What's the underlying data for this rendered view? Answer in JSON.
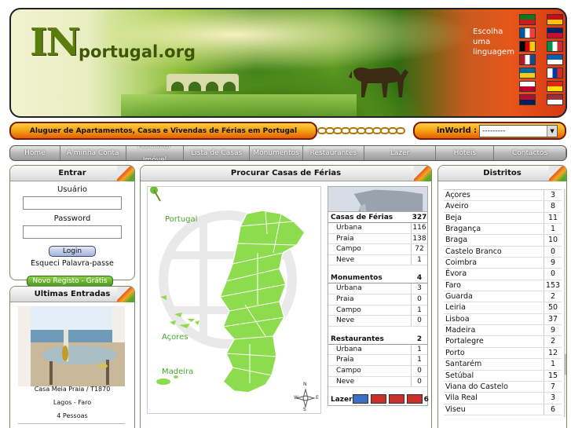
{
  "header": {
    "logo_in": "IN",
    "logo_rest": "portugal.org",
    "language_prompt": "Escolha uma linguagem",
    "flags": [
      {
        "icon": "flag-portugal-icon",
        "colors": [
          "#0a7a1a",
          "#d3171f"
        ]
      },
      {
        "icon": "flag-spain-icon",
        "colors": [
          "#c60b1e",
          "#ffc400"
        ]
      },
      {
        "icon": "flag-france-icon",
        "colors": [
          "#0055a4",
          "#ffffff",
          "#ef4135"
        ]
      },
      {
        "icon": "flag-uk-icon",
        "colors": [
          "#012169",
          "#c8102e"
        ]
      },
      {
        "icon": "flag-germany-icon",
        "colors": [
          "#000000",
          "#dd0000",
          "#ffce00"
        ]
      },
      {
        "icon": "flag-italy-icon",
        "colors": [
          "#009246",
          "#ffffff",
          "#ce2b37"
        ]
      },
      {
        "icon": "flag-netherlands-icon",
        "colors": [
          "#ae1c28",
          "#ffffff",
          "#21468b"
        ]
      },
      {
        "icon": "flag-greece-icon",
        "colors": [
          "#0d5eaf",
          "#ffffff"
        ]
      },
      {
        "icon": "flag-sweden-icon",
        "colors": [
          "#006aa7",
          "#fecc00"
        ]
      },
      {
        "icon": "flag-russia-icon",
        "colors": [
          "#ffffff",
          "#0039a6",
          "#d52b1e"
        ]
      },
      {
        "icon": "flag-japan-icon",
        "colors": [
          "#ffffff",
          "#bc002d"
        ]
      },
      {
        "icon": "flag-china-icon",
        "colors": [
          "#de2910",
          "#ffde00"
        ]
      },
      {
        "icon": "flag-norway-icon",
        "colors": [
          "#ba0c2f",
          "#00205b"
        ]
      },
      {
        "icon": "flag-latvia-icon",
        "colors": [
          "#9e3039",
          "#ffffff"
        ]
      }
    ]
  },
  "tagline": "Aluguer de Apartamentos, Casas e Vivendas de Férias em Portugal",
  "inworld": {
    "label": "inWorld :",
    "selected": "---------"
  },
  "nav": [
    "Home",
    "A minha Conta",
    "Adicionar Imóvel",
    "Lista de Casas",
    "Monumentos",
    "Restaurantes",
    "Lazer",
    "Hoteis",
    "Contactos"
  ],
  "login": {
    "title": "Entrar",
    "user_label": "Usuário",
    "password_label": "Password",
    "button": "Login",
    "forgot": "Esqueci Palavra-passe",
    "register": "Novo Registo - Grátis"
  },
  "latest": {
    "title": "Ultimas Entradas",
    "name": "Casa Meia Praia / T1870",
    "location": "Lagos - Faro",
    "people": "4 Pessoas"
  },
  "search": {
    "title": "Procurar Casas de Férias",
    "map_labels": {
      "portugal": "Portugal",
      "acores": "Açores",
      "madeira": "Madeira"
    },
    "compass": {
      "n": "N",
      "s": "S",
      "e": "E",
      "w": "W"
    },
    "stats": [
      {
        "name": "Casas de Férias",
        "total": "327",
        "rows": [
          {
            "k": "Urbana",
            "v": "116"
          },
          {
            "k": "Praia",
            "v": "138"
          },
          {
            "k": "Campo",
            "v": "72"
          },
          {
            "k": "Neve",
            "v": "1"
          }
        ]
      },
      {
        "name": "Monumentos",
        "total": "4",
        "rows": [
          {
            "k": "Urbana",
            "v": "3"
          },
          {
            "k": "Praia",
            "v": "0"
          },
          {
            "k": "Campo",
            "v": "1"
          },
          {
            "k": "Neve",
            "v": "0"
          }
        ]
      },
      {
        "name": "Restaurantes",
        "total": "2",
        "rows": [
          {
            "k": "Urbana",
            "v": "1"
          },
          {
            "k": "Praia",
            "v": "1"
          },
          {
            "k": "Campo",
            "v": "0"
          },
          {
            "k": "Neve",
            "v": "0"
          }
        ]
      }
    ],
    "lazer_label": "Lazer",
    "lazer_count": "6"
  },
  "districts": {
    "title": "Distritos",
    "rows": [
      {
        "k": "Açores",
        "v": "3"
      },
      {
        "k": "Aveiro",
        "v": "8"
      },
      {
        "k": "Beja",
        "v": "11"
      },
      {
        "k": "Bragança",
        "v": "1"
      },
      {
        "k": "Braga",
        "v": "10"
      },
      {
        "k": "Castelo Branco",
        "v": "0"
      },
      {
        "k": "Coimbra",
        "v": "9"
      },
      {
        "k": "Évora",
        "v": "0"
      },
      {
        "k": "Faro",
        "v": "153"
      },
      {
        "k": "Guarda",
        "v": "2"
      },
      {
        "k": "Leiria",
        "v": "50"
      },
      {
        "k": "Lisboa",
        "v": "37"
      },
      {
        "k": "Madeira",
        "v": "9"
      },
      {
        "k": "Portalegre",
        "v": "2"
      },
      {
        "k": "Porto",
        "v": "12"
      },
      {
        "k": "Santarém",
        "v": "1"
      },
      {
        "k": "Setúbal",
        "v": "15"
      },
      {
        "k": "Viana do Castelo",
        "v": "7"
      },
      {
        "k": "Vila Real",
        "v": "3"
      },
      {
        "k": "Viseu",
        "v": "6"
      }
    ]
  }
}
